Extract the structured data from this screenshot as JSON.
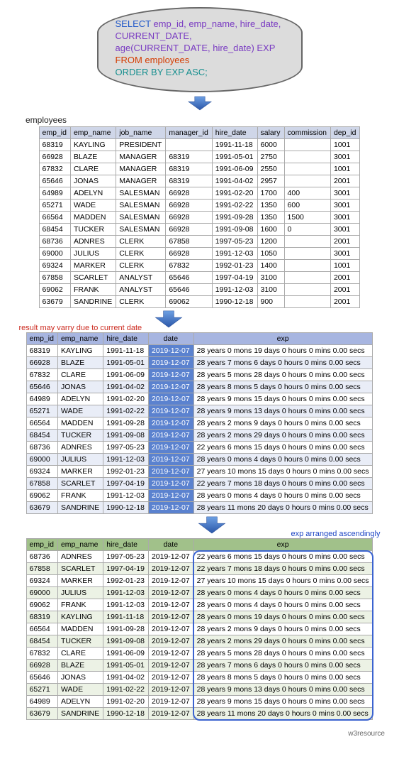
{
  "sql": {
    "line1a": "SELECT ",
    "line1b": "emp_id, emp_name, hire_date,",
    "line2a": "CURRENT_DATE,",
    "line2b": "age(CURRENT_DATE, hire_date) EXP",
    "line3a": "FROM ",
    "line3b": "employees",
    "line4": "ORDER BY EXP ASC;"
  },
  "label_employees": "employees",
  "note_red": "result may varry due to current date",
  "note_blue": "exp arranged ascendingly",
  "footer": "w3resource",
  "t1": {
    "headers": [
      "emp_id",
      "emp_name",
      "job_name",
      "manager_id",
      "hire_date",
      "salary",
      "commission",
      "dep_id"
    ],
    "rows": [
      [
        "68319",
        "KAYLING",
        "PRESIDENT",
        "",
        "1991-11-18",
        "6000",
        "",
        "1001"
      ],
      [
        "66928",
        "BLAZE",
        "MANAGER",
        "68319",
        "1991-05-01",
        "2750",
        "",
        "3001"
      ],
      [
        "67832",
        "CLARE",
        "MANAGER",
        "68319",
        "1991-06-09",
        "2550",
        "",
        "1001"
      ],
      [
        "65646",
        "JONAS",
        "MANAGER",
        "68319",
        "1991-04-02",
        "2957",
        "",
        "2001"
      ],
      [
        "64989",
        "ADELYN",
        "SALESMAN",
        "66928",
        "1991-02-20",
        "1700",
        "400",
        "3001"
      ],
      [
        "65271",
        "WADE",
        "SALESMAN",
        "66928",
        "1991-02-22",
        "1350",
        "600",
        "3001"
      ],
      [
        "66564",
        "MADDEN",
        "SALESMAN",
        "66928",
        "1991-09-28",
        "1350",
        "1500",
        "3001"
      ],
      [
        "68454",
        "TUCKER",
        "SALESMAN",
        "66928",
        "1991-09-08",
        "1600",
        "0",
        "3001"
      ],
      [
        "68736",
        "ADNRES",
        "CLERK",
        "67858",
        "1997-05-23",
        "1200",
        "",
        "2001"
      ],
      [
        "69000",
        "JULIUS",
        "CLERK",
        "66928",
        "1991-12-03",
        "1050",
        "",
        "3001"
      ],
      [
        "69324",
        "MARKER",
        "CLERK",
        "67832",
        "1992-01-23",
        "1400",
        "",
        "1001"
      ],
      [
        "67858",
        "SCARLET",
        "ANALYST",
        "65646",
        "1997-04-19",
        "3100",
        "",
        "2001"
      ],
      [
        "69062",
        "FRANK",
        "ANALYST",
        "65646",
        "1991-12-03",
        "3100",
        "",
        "2001"
      ],
      [
        "63679",
        "SANDRINE",
        "CLERK",
        "69062",
        "1990-12-18",
        "900",
        "",
        "2001"
      ]
    ]
  },
  "t2": {
    "headers": [
      "emp_id",
      "emp_name",
      "hire_date",
      "date",
      "exp"
    ],
    "rows": [
      [
        "68319",
        "KAYLING",
        "1991-11-18",
        "2019-12-07",
        "28 years 0 mons 19 days 0 hours 0 mins 0.00 secs"
      ],
      [
        "66928",
        "BLAZE",
        "1991-05-01",
        "2019-12-07",
        "28 years 7 mons 6 days 0 hours 0 mins 0.00 secs"
      ],
      [
        "67832",
        "CLARE",
        "1991-06-09",
        "2019-12-07",
        "28 years 5 mons 28 days 0 hours 0 mins 0.00 secs"
      ],
      [
        "65646",
        "JONAS",
        "1991-04-02",
        "2019-12-07",
        "28 years 8 mons 5 days 0 hours 0 mins 0.00 secs"
      ],
      [
        "64989",
        "ADELYN",
        "1991-02-20",
        "2019-12-07",
        "28 years 9 mons 15 days 0 hours 0 mins 0.00 secs"
      ],
      [
        "65271",
        "WADE",
        "1991-02-22",
        "2019-12-07",
        "28 years 9 mons 13 days 0 hours 0 mins 0.00 secs"
      ],
      [
        "66564",
        "MADDEN",
        "1991-09-28",
        "2019-12-07",
        "28 years 2 mons 9 days 0 hours 0 mins 0.00 secs"
      ],
      [
        "68454",
        "TUCKER",
        "1991-09-08",
        "2019-12-07",
        "28 years 2 mons 29 days 0 hours 0 mins 0.00 secs"
      ],
      [
        "68736",
        "ADNRES",
        "1997-05-23",
        "2019-12-07",
        "22 years 6 mons 15 days 0 hours 0 mins 0.00 secs"
      ],
      [
        "69000",
        "JULIUS",
        "1991-12-03",
        "2019-12-07",
        "28 years 0 mons 4 days 0 hours 0 mins 0.00 secs"
      ],
      [
        "69324",
        "MARKER",
        "1992-01-23",
        "2019-12-07",
        "27 years 10 mons 15 days 0 hours 0 mins 0.00 secs"
      ],
      [
        "67858",
        "SCARLET",
        "1997-04-19",
        "2019-12-07",
        "22 years 7 mons 18 days 0 hours 0 mins 0.00 secs"
      ],
      [
        "69062",
        "FRANK",
        "1991-12-03",
        "2019-12-07",
        "28 years 0 mons 4 days 0 hours 0 mins 0.00 secs"
      ],
      [
        "63679",
        "SANDRINE",
        "1990-12-18",
        "2019-12-07",
        "28 years 11 mons 20 days 0 hours 0 mins 0.00 secs"
      ]
    ]
  },
  "t3": {
    "headers": [
      "emp_id",
      "emp_name",
      "hire_date",
      "date",
      "exp"
    ],
    "rows": [
      [
        "68736",
        "ADNRES",
        "1997-05-23",
        "2019-12-07",
        "22 years 6 mons 15 days 0 hours 0 mins 0.00 secs"
      ],
      [
        "67858",
        "SCARLET",
        "1997-04-19",
        "2019-12-07",
        "22 years 7 mons 18 days 0 hours 0 mins 0.00 secs"
      ],
      [
        "69324",
        "MARKER",
        "1992-01-23",
        "2019-12-07",
        "27 years 10 mons 15 days 0 hours 0 mins 0.00 secs"
      ],
      [
        "69000",
        "JULIUS",
        "1991-12-03",
        "2019-12-07",
        "28 years 0 mons 4 days 0 hours 0 mins 0.00 secs"
      ],
      [
        "69062",
        "FRANK",
        "1991-12-03",
        "2019-12-07",
        "28 years 0 mons 4 days 0 hours 0 mins 0.00 secs"
      ],
      [
        "68319",
        "KAYLING",
        "1991-11-18",
        "2019-12-07",
        "28 years 0 mons 19 days 0 hours 0 mins 0.00 secs"
      ],
      [
        "66564",
        "MADDEN",
        "1991-09-28",
        "2019-12-07",
        "28 years 2 mons 9 days 0 hours 0 mins 0.00 secs"
      ],
      [
        "68454",
        "TUCKER",
        "1991-09-08",
        "2019-12-07",
        "28 years 2 mons 29 days 0 hours 0 mins 0.00 secs"
      ],
      [
        "67832",
        "CLARE",
        "1991-06-09",
        "2019-12-07",
        "28 years 5 mons 28 days 0 hours 0 mins 0.00 secs"
      ],
      [
        "66928",
        "BLAZE",
        "1991-05-01",
        "2019-12-07",
        "28 years 7 mons 6 days 0 hours 0 mins 0.00 secs"
      ],
      [
        "65646",
        "JONAS",
        "1991-04-02",
        "2019-12-07",
        "28 years 8 mons 5 days 0 hours 0 mins 0.00 secs"
      ],
      [
        "65271",
        "WADE",
        "1991-02-22",
        "2019-12-07",
        "28 years 9 mons 13 days 0 hours 0 mins 0.00 secs"
      ],
      [
        "64989",
        "ADELYN",
        "1991-02-20",
        "2019-12-07",
        "28 years 9 mons 15 days 0 hours 0 mins 0.00 secs"
      ],
      [
        "63679",
        "SANDRINE",
        "1990-12-18",
        "2019-12-07",
        "28 years 11 mons 20 days 0 hours 0 mins 0.00 secs"
      ]
    ]
  }
}
